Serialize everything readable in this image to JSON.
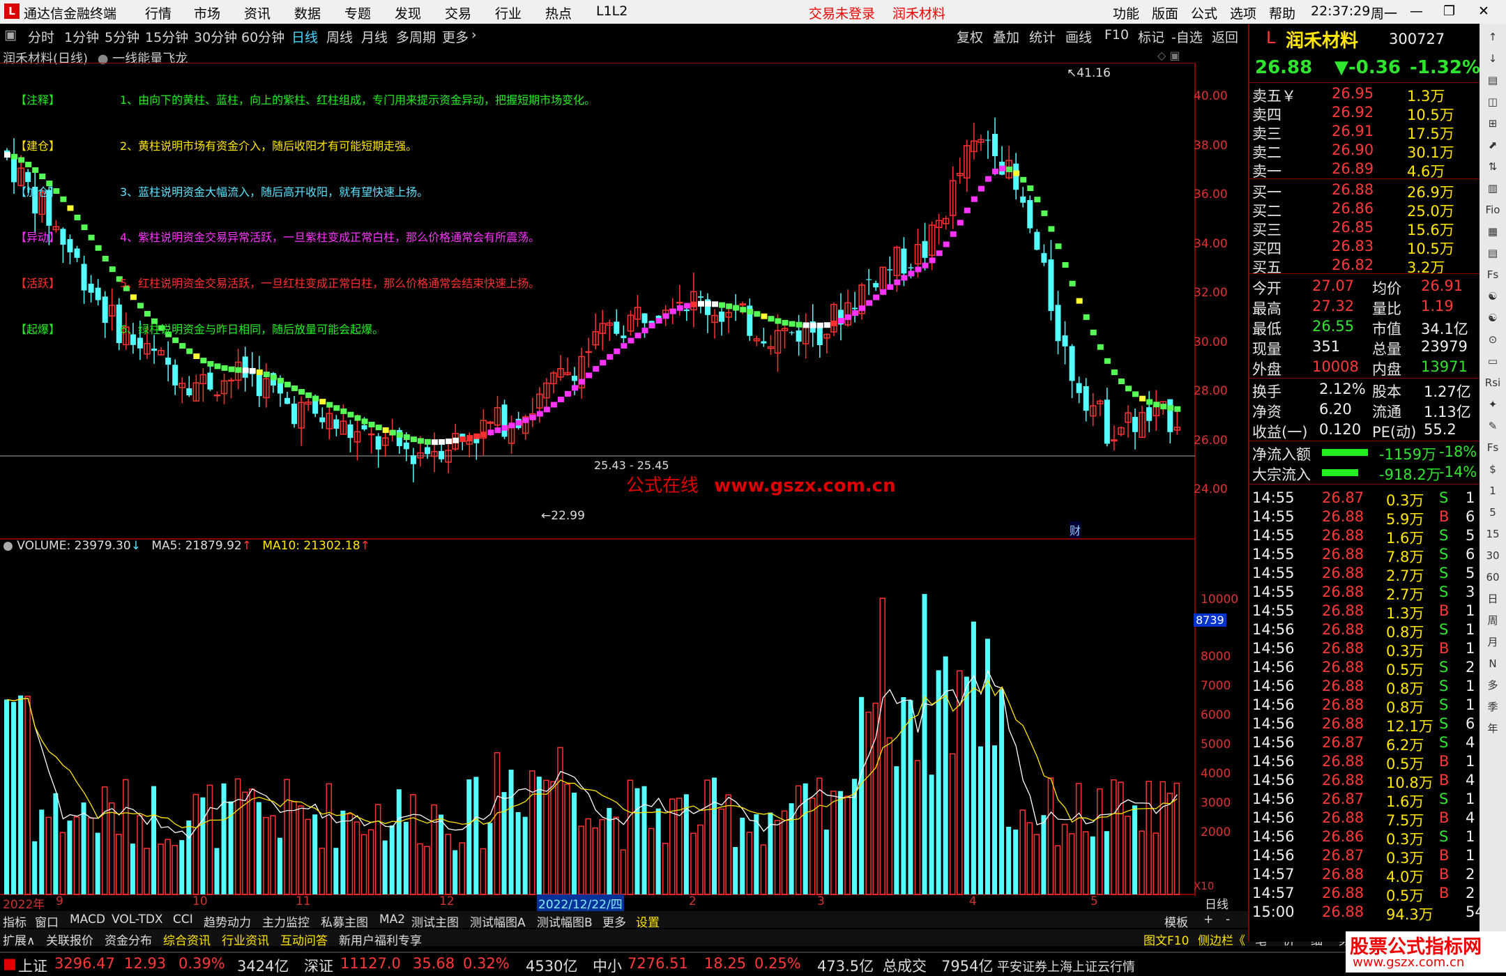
{
  "app": {
    "title": "通达信金融终端",
    "warning_login": "交易未登录",
    "stock_title": "润禾材料"
  },
  "menu": [
    "行情",
    "市场",
    "资讯",
    "数据",
    "专题",
    "发现",
    "交易",
    "行业",
    "热点",
    "L1L2"
  ],
  "menu_right": [
    "功能",
    "版面",
    "公式",
    "选项",
    "帮助"
  ],
  "clock": "22:37:29",
  "weekday": "周一",
  "periods": [
    "分时",
    "1分钟",
    "5分钟",
    "15分钟",
    "30分钟",
    "60分钟",
    "日线",
    "周线",
    "月线",
    "多周期",
    "更多"
  ],
  "selected_period": "日线",
  "tools": [
    "复权",
    "叠加",
    "统计",
    "画线",
    "F10",
    "标记",
    "-自选",
    "返回"
  ],
  "chart_header": {
    "name": "润禾材料(日线)",
    "indicator": "一线能量飞龙"
  },
  "annotations": [
    {
      "tag": "【注释】",
      "text": "1、由向下的黄柱、蓝柱，向上的紫柱、红柱组成，专门用来提示资金异动，把握短期市场变化。",
      "color": "#22ee22"
    },
    {
      "tag": "【建仓】",
      "text": "2、黄柱说明市场有资金介入，随后收阳才有可能短期走强。",
      "color": "#ffe600"
    },
    {
      "tag": "【加仓】",
      "text": "3、蓝柱说明资金大幅流入，随后高开收阳，就有望快速上扬。",
      "color": "#5ae5ff"
    },
    {
      "tag": "【异动】",
      "text": "4、紫柱说明资金交易异常活跃，一旦紫柱变成正常白柱，那么价格通常会有所震荡。",
      "color": "#ff33ff"
    },
    {
      "tag": "【活跃】",
      "text": "5、红柱说明资金交易活跃，一旦红柱变成正常白柱，那么价格通常会结束快速上扬。",
      "color": "#ff3030"
    },
    {
      "tag": "【起爆】",
      "text": "6、绿柱说明资金与昨日相同，随后放量可能会起爆。",
      "color": "#22ee22"
    }
  ],
  "watermark": {
    "cn": "公式在线",
    "url": "www.gszx.com.cn"
  },
  "price_axis": [
    "40.00",
    "38.00",
    "36.00",
    "34.00",
    "32.00",
    "30.00",
    "28.00",
    "26.00",
    "24.00"
  ],
  "price_marks": {
    "high": "41.16",
    "low": "22.99",
    "range": "25.43 - 25.45",
    "cai": "财"
  },
  "volume_header": {
    "volume": "VOLUME: 23979.30",
    "ma5": "MA5: 21879.92",
    "ma10": "MA10: 21302.18"
  },
  "volume_axis": [
    "10000",
    "8000",
    "7000",
    "6000",
    "5000",
    "4000",
    "3000",
    "2000"
  ],
  "volume_marker": "8739",
  "volume_unit": "X10",
  "date_axis": [
    "2022年",
    "9",
    "10",
    "11",
    "12",
    "2022/12/22/四",
    "2",
    "3",
    "4",
    "5",
    "日线"
  ],
  "tabs_row1": [
    "指标",
    "窗口",
    "MACD",
    "VOL-TDX",
    "CCI",
    "趋势动力",
    "主力监控",
    "私募主图",
    "MA2",
    "测试主图",
    "测试幅图A",
    "测试幅图B",
    "更多",
    "设置"
  ],
  "tabs_row1_right": [
    "模板",
    "+",
    "-"
  ],
  "tabs_row2": [
    "扩展∧",
    "关联报价",
    "资金分布",
    "综合资讯",
    "行业资讯",
    "互动问答",
    "新用户福利专享"
  ],
  "tabs_row2_right": [
    "图文F10",
    "侧边栏《",
    "笔",
    "价",
    "细",
    "势"
  ],
  "quote": {
    "name": "润禾材料",
    "code": "300727",
    "price": "26.88",
    "change": "▼-0.36",
    "pct": "-1.32%",
    "asks": [
      {
        "label": "卖五￥",
        "price": "26.95",
        "vol": "1.3万"
      },
      {
        "label": "卖四",
        "price": "26.92",
        "vol": "10.5万"
      },
      {
        "label": "卖三",
        "price": "26.91",
        "vol": "17.5万"
      },
      {
        "label": "卖二",
        "price": "26.90",
        "vol": "30.1万"
      },
      {
        "label": "卖一",
        "price": "26.89",
        "vol": "4.6万"
      }
    ],
    "bids": [
      {
        "label": "买一",
        "price": "26.88",
        "vol": "26.9万"
      },
      {
        "label": "买二",
        "price": "26.86",
        "vol": "25.0万"
      },
      {
        "label": "买三",
        "price": "26.85",
        "vol": "15.6万"
      },
      {
        "label": "买四",
        "price": "26.83",
        "vol": "10.5万"
      },
      {
        "label": "买五",
        "price": "26.82",
        "vol": "3.2万"
      }
    ],
    "stats": [
      {
        "l1": "今开",
        "v1": "27.07",
        "c1": "red",
        "l2": "均价",
        "v2": "26.91",
        "c2": "red"
      },
      {
        "l1": "最高",
        "v1": "27.32",
        "c1": "red",
        "l2": "量比",
        "v2": "1.19",
        "c2": "red"
      },
      {
        "l1": "最低",
        "v1": "26.55",
        "c1": "grn",
        "l2": "市值",
        "v2": "34.1亿",
        "c2": "wht"
      },
      {
        "l1": "现量",
        "v1": "351",
        "c1": "wht",
        "l2": "总量",
        "v2": "23979",
        "c2": "wht"
      },
      {
        "l1": "外盘",
        "v1": "10008",
        "c1": "red",
        "l2": "内盘",
        "v2": "13971",
        "c2": "grn"
      }
    ],
    "stats2": [
      {
        "l1": "换手",
        "v1": "2.12%",
        "l2": "股本",
        "v2": "1.27亿"
      },
      {
        "l1": "净资",
        "v1": "6.20",
        "l2": "流通",
        "v2": "1.13亿"
      },
      {
        "l1": "收益(一)",
        "v1": "0.120",
        "l2": "PE(动)",
        "v2": "55.2"
      }
    ],
    "flows": [
      {
        "label": "净流入额",
        "val": "-1159万",
        "pct": "-18%"
      },
      {
        "label": "大宗流入",
        "val": "-918.2万",
        "pct": "-14%"
      }
    ]
  },
  "ticks": [
    [
      "14:55",
      "26.87",
      "0.3万",
      "S",
      "1"
    ],
    [
      "14:55",
      "26.88",
      "5.9万",
      "B",
      "6"
    ],
    [
      "14:55",
      "26.88",
      "1.6万",
      "S",
      "5"
    ],
    [
      "14:55",
      "26.88",
      "7.8万",
      "S",
      "6"
    ],
    [
      "14:55",
      "26.88",
      "2.7万",
      "S",
      "5"
    ],
    [
      "14:55",
      "26.88",
      "2.7万",
      "S",
      "3"
    ],
    [
      "14:55",
      "26.88",
      "1.3万",
      "B",
      "1"
    ],
    [
      "14:56",
      "26.88",
      "0.8万",
      "S",
      "1"
    ],
    [
      "14:56",
      "26.88",
      "0.3万",
      "B",
      "1"
    ],
    [
      "14:56",
      "26.88",
      "0.5万",
      "S",
      "2"
    ],
    [
      "14:56",
      "26.88",
      "0.8万",
      "S",
      "1"
    ],
    [
      "14:56",
      "26.88",
      "0.8万",
      "S",
      "1"
    ],
    [
      "14:56",
      "26.88",
      "12.1万",
      "S",
      "6"
    ],
    [
      "14:56",
      "26.87",
      "6.2万",
      "S",
      "4"
    ],
    [
      "14:56",
      "26.88",
      "0.5万",
      "B",
      "1"
    ],
    [
      "14:56",
      "26.88",
      "10.8万",
      "B",
      "4"
    ],
    [
      "14:56",
      "26.87",
      "1.6万",
      "S",
      "1"
    ],
    [
      "14:56",
      "26.88",
      "7.5万",
      "B",
      "4"
    ],
    [
      "14:56",
      "26.86",
      "0.3万",
      "S",
      "1"
    ],
    [
      "14:56",
      "26.87",
      "0.3万",
      "B",
      "1"
    ],
    [
      "14:57",
      "26.88",
      "4.0万",
      "B",
      "2"
    ],
    [
      "14:57",
      "26.88",
      "0.5万",
      "B",
      "2"
    ],
    [
      "15:00",
      "26.88",
      "94.3万",
      "",
      "54"
    ]
  ],
  "iconbar": [
    "↑",
    "↓",
    "▤",
    "◫",
    "⊞",
    "⬈",
    "⇅",
    "▥",
    "Fio",
    "▦",
    "▤",
    "Fs",
    "☯",
    "☯",
    "⊙",
    "▭",
    "Rsi",
    "✦",
    "✎",
    "Fs",
    "$",
    "1",
    "5",
    "15",
    "30",
    "60",
    "日",
    "周",
    "月",
    "N",
    "多",
    "季",
    "年"
  ],
  "status": {
    "sh_label": "上证",
    "sh_val": "3296.47",
    "sh_chg": "12.93",
    "sh_pct": "0.39%",
    "sh_amt": "3424亿",
    "sz_label": "深证",
    "sz_val": "11127.0",
    "sz_chg": "35.68",
    "sz_pct": "0.32%",
    "sz_amt": "4530亿",
    "zx_label": "中小",
    "zx_val": "7276.51",
    "zx_chg": "18.25",
    "zx_pct": "0.25%",
    "zx_amt": "473.5亿",
    "tot_label": "总成交",
    "tot_val": "7954亿",
    "broker": "平安证券上海上证云行情"
  },
  "brand": {
    "big": "股票公式指标网",
    "small": "www.gszx.com.cn"
  }
}
